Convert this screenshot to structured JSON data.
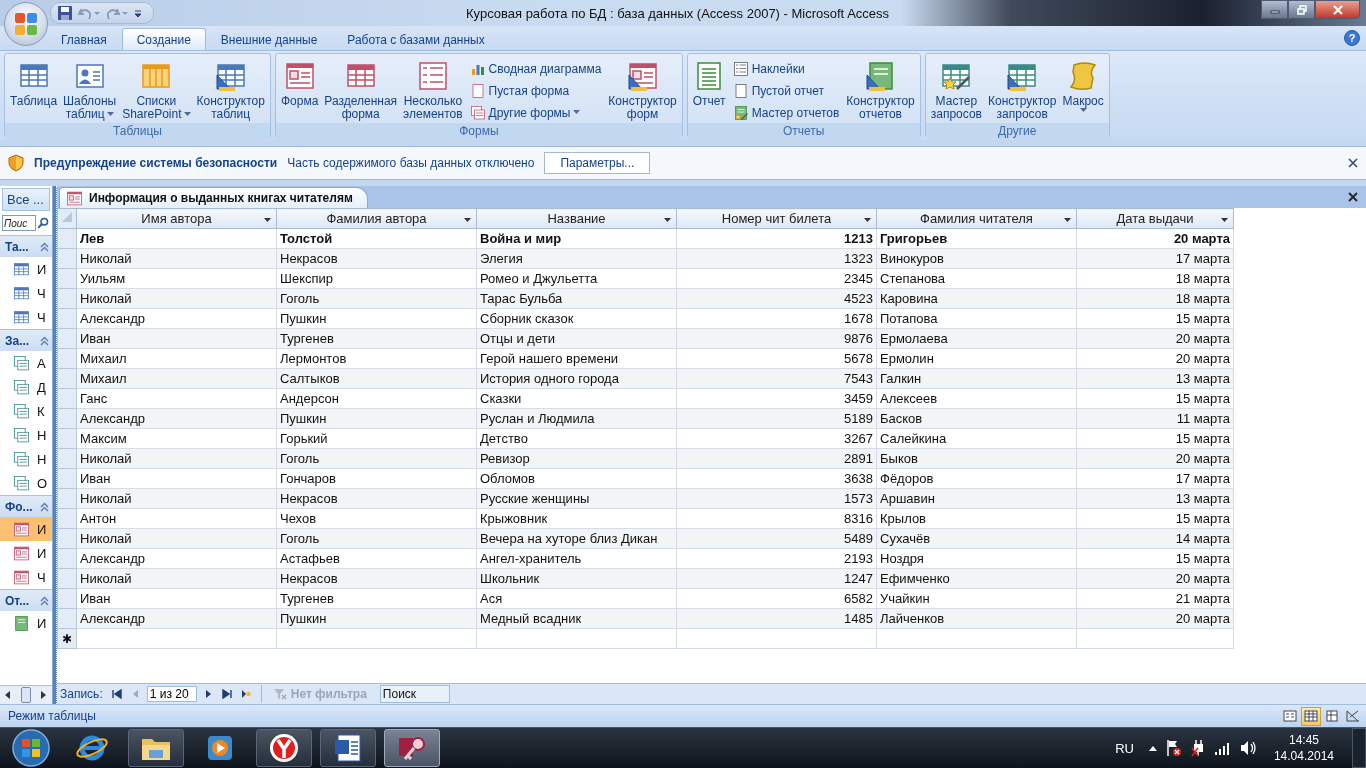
{
  "window": {
    "title": "Курсовая работа по БД : база данных (Access 2007) - Microsoft Access"
  },
  "ribbon": {
    "tabs": [
      {
        "label": "Главная",
        "selected": false
      },
      {
        "label": "Создание",
        "selected": true
      },
      {
        "label": "Внешние данные",
        "selected": false
      },
      {
        "label": "Работа с базами данных",
        "selected": false
      }
    ],
    "help": "?",
    "groups": [
      {
        "label": "Таблицы",
        "items": [
          {
            "kind": "large",
            "lines": [
              "Таблица"
            ],
            "dropdown": false
          },
          {
            "kind": "large",
            "lines": [
              "Шаблоны",
              "таблиц"
            ],
            "dropdown": true
          },
          {
            "kind": "large",
            "lines": [
              "Списки",
              "SharePoint"
            ],
            "dropdown": true
          },
          {
            "kind": "large",
            "lines": [
              "Конструктор",
              "таблиц"
            ],
            "dropdown": false
          }
        ]
      },
      {
        "label": "Формы",
        "items": [
          {
            "kind": "large",
            "lines": [
              "Форма"
            ],
            "dropdown": false
          },
          {
            "kind": "large",
            "lines": [
              "Разделенная",
              "форма"
            ],
            "dropdown": false
          },
          {
            "kind": "large",
            "lines": [
              "Несколько",
              "элементов"
            ],
            "dropdown": false
          },
          {
            "kind": "stack",
            "items": [
              {
                "label": "Сводная диаграмма",
                "dropdown": false
              },
              {
                "label": "Пустая форма",
                "dropdown": false
              },
              {
                "label": "Другие формы",
                "dropdown": true
              }
            ]
          },
          {
            "kind": "large",
            "lines": [
              "Конструктор",
              "форм"
            ],
            "dropdown": false
          }
        ]
      },
      {
        "label": "Отчеты",
        "items": [
          {
            "kind": "large",
            "lines": [
              "Отчет"
            ],
            "dropdown": false
          },
          {
            "kind": "stack",
            "items": [
              {
                "label": "Наклейки",
                "dropdown": false
              },
              {
                "label": "Пустой отчет",
                "dropdown": false
              },
              {
                "label": "Мастер отчетов",
                "dropdown": false
              }
            ]
          },
          {
            "kind": "large",
            "lines": [
              "Конструктор",
              "отчетов"
            ],
            "dropdown": false
          }
        ]
      },
      {
        "label": "Другие",
        "items": [
          {
            "kind": "large",
            "lines": [
              "Мастер",
              "запросов"
            ],
            "dropdown": false
          },
          {
            "kind": "large",
            "lines": [
              "Конструктор",
              "запросов"
            ],
            "dropdown": false
          },
          {
            "kind": "large",
            "lines": [
              "Макрос"
            ],
            "dropdown": true
          }
        ]
      }
    ]
  },
  "security_bar": {
    "title": "Предупреждение системы безопасности",
    "message": "Часть содержимого базы данных отключено",
    "button": "Параметры..."
  },
  "nav_pane": {
    "header": "Все ...",
    "search": {
      "placeholder": "Поис"
    },
    "sections": [
      {
        "kind": "tables",
        "label": "Та...",
        "expanded": true,
        "items": [
          {
            "label": "И",
            "selected": false
          },
          {
            "label": "Ч",
            "selected": false
          },
          {
            "label": "Ч",
            "selected": false
          }
        ]
      },
      {
        "kind": "queries",
        "label": "За...",
        "expanded": true,
        "items": [
          {
            "label": "А",
            "selected": false
          },
          {
            "label": "Д",
            "selected": false
          },
          {
            "label": "К",
            "selected": false
          },
          {
            "label": "Н",
            "selected": false
          },
          {
            "label": "Н",
            "selected": false
          },
          {
            "label": "О",
            "selected": false
          }
        ]
      },
      {
        "kind": "forms",
        "label": "Фо...",
        "expanded": true,
        "items": [
          {
            "label": "И",
            "selected": true
          },
          {
            "label": "И",
            "selected": false
          },
          {
            "label": "Ч",
            "selected": false
          }
        ]
      },
      {
        "kind": "reports",
        "label": "От...",
        "expanded": true,
        "items": [
          {
            "label": "И",
            "selected": false
          }
        ]
      }
    ]
  },
  "document": {
    "tab": "Информация о выданных книгах читателям",
    "columns": [
      "Имя автора",
      "Фамилия автора",
      "Название",
      "Номер чит билета",
      "Фамилия читателя",
      "Дата выдачи"
    ],
    "rows": [
      {
        "selected": true,
        "cells": [
          "Лев",
          "Толстой",
          "Война и мир",
          "1213",
          "Григорьев",
          "20 марта"
        ]
      },
      {
        "selected": false,
        "cells": [
          "Николай",
          "Некрасов",
          "Элегия",
          "1323",
          "Винокуров",
          "17 марта"
        ]
      },
      {
        "selected": false,
        "cells": [
          "Уильям",
          "Шекспир",
          "Ромео и Джульетта",
          "2345",
          "Степанова",
          "18 марта"
        ]
      },
      {
        "selected": false,
        "cells": [
          "Николай",
          "Гоголь",
          "Тарас Бульба",
          "4523",
          "Каровина",
          "18 марта"
        ]
      },
      {
        "selected": false,
        "cells": [
          "Александр",
          "Пушкин",
          "Сборник сказок",
          "1678",
          "Потапова",
          "15 марта"
        ]
      },
      {
        "selected": false,
        "cells": [
          "Иван",
          "Тургенев",
          "Отцы и дети",
          "9876",
          "Ермолаева",
          "20 марта"
        ]
      },
      {
        "selected": false,
        "cells": [
          "Михаил",
          "Лермонтов",
          "Герой нашего времени",
          "5678",
          "Ермолин",
          "20 марта"
        ]
      },
      {
        "selected": false,
        "cells": [
          "Михаил",
          "Салтыков",
          "История одного города",
          "7543",
          "Галкин",
          "13 марта"
        ]
      },
      {
        "selected": false,
        "cells": [
          "Ганс",
          "Андерсон",
          "Сказки",
          "3459",
          "Алексеев",
          "15 марта"
        ]
      },
      {
        "selected": false,
        "cells": [
          "Александр",
          "Пушкин",
          "Руслан и Людмила",
          "5189",
          "Басков",
          "11 марта"
        ]
      },
      {
        "selected": false,
        "cells": [
          "Максим",
          "Горький",
          "Детство",
          "3267",
          "Салейкина",
          "15 марта"
        ]
      },
      {
        "selected": false,
        "cells": [
          "Николай",
          "Гоголь",
          "Ревизор",
          "2891",
          "Быков",
          "20 марта"
        ]
      },
      {
        "selected": false,
        "cells": [
          "Иван",
          "Гончаров",
          "Обломов",
          "3638",
          "Фёдоров",
          "17 марта"
        ]
      },
      {
        "selected": false,
        "cells": [
          "Николай",
          "Некрасов",
          "Русские женщины",
          "1573",
          "Аршавин",
          "13 марта"
        ]
      },
      {
        "selected": false,
        "cells": [
          "Антон",
          "Чехов",
          "Крыжовник",
          "8316",
          "Крылов",
          "15 марта"
        ]
      },
      {
        "selected": false,
        "cells": [
          "Николай",
          "Гоголь",
          "Вечера на хуторе близ Дикан",
          "5489",
          "Сухачёв",
          "14 марта"
        ]
      },
      {
        "selected": false,
        "cells": [
          "Александр",
          "Астафьев",
          "Ангел-хранитель",
          "2193",
          "Ноздря",
          "15 марта"
        ]
      },
      {
        "selected": false,
        "cells": [
          "Николай",
          "Некрасов",
          "Школьник",
          "1247",
          "Ефимченко",
          "20 марта"
        ]
      },
      {
        "selected": false,
        "cells": [
          "Иван",
          "Тургенев",
          "Ася",
          "6582",
          "Учайкин",
          "21 марта"
        ]
      },
      {
        "selected": false,
        "cells": [
          "Александр",
          "Пушкин",
          "Медный всадник",
          "1485",
          "Лайченков",
          "20 марта"
        ]
      }
    ],
    "new_row_marker": "✱"
  },
  "record_nav": {
    "label": "Запись:",
    "position": "1 из 20",
    "filter": "Нет фильтра",
    "search": {
      "placeholder": "Поиск"
    },
    "buttons": [
      {
        "kind": "first",
        "disabled": false
      },
      {
        "kind": "prev",
        "disabled": true
      },
      {
        "kind": "next",
        "disabled": false
      },
      {
        "kind": "last",
        "disabled": false
      },
      {
        "kind": "new",
        "disabled": false
      }
    ]
  },
  "status_bar": {
    "text": "Режим таблицы",
    "views": [
      {
        "kind": "form",
        "selected": false
      },
      {
        "kind": "datasheet",
        "selected": true
      },
      {
        "kind": "pivot",
        "selected": false
      },
      {
        "kind": "design",
        "selected": false
      }
    ]
  },
  "taskbar": {
    "apps": [
      {
        "kind": "ie",
        "running": false,
        "active": false
      },
      {
        "kind": "explorer",
        "running": true,
        "active": false
      },
      {
        "kind": "media",
        "running": false,
        "active": false
      },
      {
        "kind": "yandex",
        "running": true,
        "active": false
      },
      {
        "kind": "word",
        "running": true,
        "active": false
      },
      {
        "kind": "access",
        "running": true,
        "active": true
      }
    ],
    "language": "RU",
    "time": "14:45",
    "date": "14.04.2014"
  }
}
